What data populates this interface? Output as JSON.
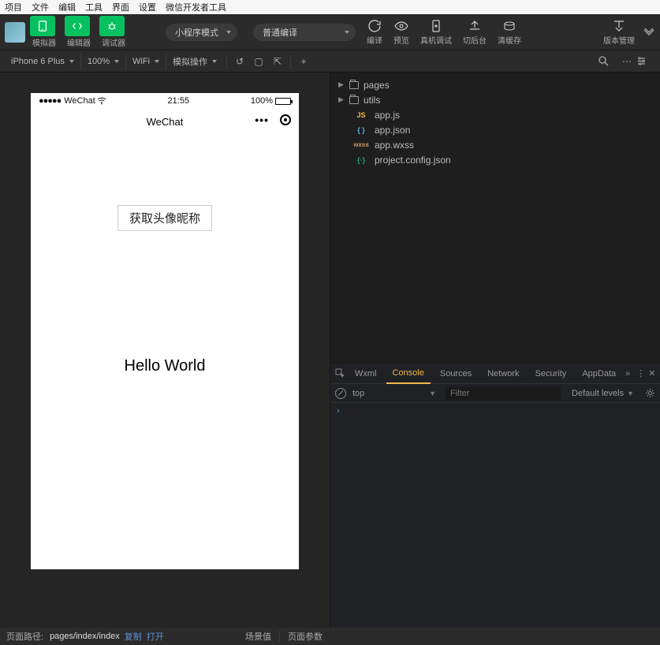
{
  "menubar": [
    "项目",
    "文件",
    "编辑",
    "工具",
    "界面",
    "设置",
    "微信开发者工具"
  ],
  "toolbar1": {
    "simulator": "模拟器",
    "editor": "编辑器",
    "debugger": "调试器",
    "mode": "小程序模式",
    "compile": "普通编译",
    "actions": {
      "compileL": "编译",
      "preview": "预览",
      "remote": "真机调试",
      "back": "切后台",
      "clear": "清缓存",
      "version": "版本管理"
    }
  },
  "toolbar2": {
    "device": "iPhone 6 Plus",
    "zoom": "100%",
    "network": "WiFi",
    "mock": "模拟操作"
  },
  "phone": {
    "carrier": "WeChat",
    "time": "21:55",
    "battery": "100%",
    "title": "WeChat",
    "button": "获取头像昵称",
    "hello": "Hello World"
  },
  "tree": {
    "pages": "pages",
    "utils": "utils",
    "appjs": "app.js",
    "appjson": "app.json",
    "appwxss": "app.wxss",
    "config": "project.config.json"
  },
  "devtools": {
    "tabs": [
      "Wxml",
      "Console",
      "Sources",
      "Network",
      "Security",
      "AppData"
    ],
    "top": "top",
    "filterPh": "Filter",
    "levels": "Default levels",
    "prompt": "›"
  },
  "footer": {
    "pathLabel": "页面路径:",
    "path": "pages/index/index",
    "copy": "复制",
    "open": "打开",
    "scene": "场景值",
    "params": "页面参数"
  }
}
